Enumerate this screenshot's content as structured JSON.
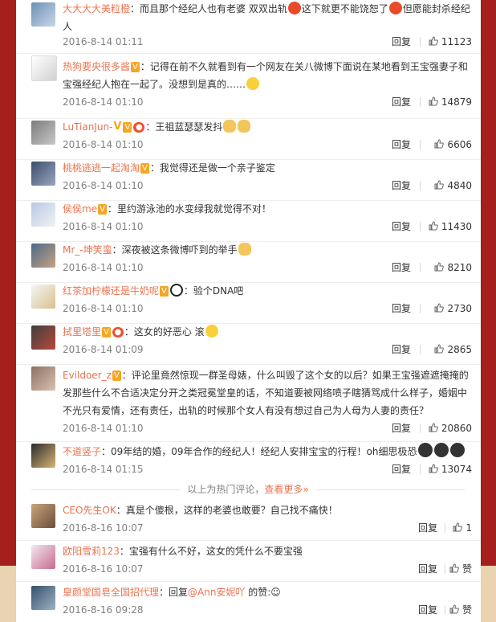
{
  "colors": {
    "background": "#a5201c",
    "panel": "#ffffff",
    "username": "#eb7350",
    "meta": "#808080",
    "bottom_band": "#e9d3b1"
  },
  "hot_comments": [
    {
      "user": "大大大大美粒橙",
      "text": "：而且那个经纪人也有老婆 双双出轨",
      "text_b": "这下就更不能饶恕了",
      "text_c": "但愿能封杀经纪人",
      "time": "2016-8-14 01:11",
      "reply": "回复",
      "likes": "11123"
    },
    {
      "user": "热狗要央很多酱",
      "text": "：记得在前不久就看到有一个网友在关八微博下面说在某地看到王宝强妻子和宝强经纪人抱在一起了。没想到是真的……",
      "time": "2016-8-14 01:10",
      "reply": "回复",
      "likes": "14879"
    },
    {
      "user": "LuTianJun-",
      "text": "：王祖蓝瑟瑟发抖",
      "time": "2016-8-14 01:10",
      "reply": "回复",
      "likes": "6606"
    },
    {
      "user": "桃桃逃逃一起淘淘",
      "text": "：我觉得还是做一个亲子鉴定",
      "time": "2016-8-14 01:10",
      "reply": "回复",
      "likes": "4840"
    },
    {
      "user": "侯侯me",
      "text": "：里约游泳池的水变绿我就觉得不对！",
      "time": "2016-8-14 01:10",
      "reply": "回复",
      "likes": "11430"
    },
    {
      "user": "Mr_-坤笑蛮",
      "text": "：深夜被这条微博吓到的举手",
      "time": "2016-8-14 01:10",
      "reply": "回复",
      "likes": "8210"
    },
    {
      "user": "红茶加柠檬还是牛奶呢",
      "text": "：验个DNA吧",
      "time": "2016-8-14 01:10",
      "reply": "回复",
      "likes": "2730"
    },
    {
      "user": "拭里塔里",
      "text": "：这女的好恶心 滚",
      "time": "2016-8-14 01:09",
      "reply": "回复",
      "likes": "2865"
    },
    {
      "user": "Evildoer_z",
      "text": "：评论里竟然惊现一群圣母婊，什么叫毁了这个女的以后？如果王宝强遮遮掩掩的发那些什么不合适决定分开之类冠冕堂皇的话，不知道要被网络喷子瞎猜骂成什么样子，婚姻中不光只有爱情，还有责任，出轨的时候那个女人有没有想过自己为人母为人妻的责任？",
      "time": "2016-8-14 01:10",
      "reply": "回复",
      "likes": "20860"
    },
    {
      "user": "不道竖子",
      "text": "：09年结的婚，09年合作的经纪人！经纪人安排宝宝的行程！oh细思极恐",
      "time": "2016-8-14 01:15",
      "reply": "回复",
      "likes": "13074"
    }
  ],
  "divider": {
    "text": "以上为热门评论，",
    "more_link": "查看更多»"
  },
  "new_comments": [
    {
      "user": "CEO先生OK",
      "text": "：真是个傻根，这样的老婆也敢要？自己找不痛快！",
      "time": "2016-8-16 10:07",
      "reply": "回复",
      "likes": "1"
    },
    {
      "user": "欧阳雪莉123",
      "text": "：宝强有什么不好，这女的凭什么不要宝强",
      "time": "2016-8-16 10:07",
      "reply": "回复",
      "likes": "赞"
    },
    {
      "user": "皇颜堂国皂全国招代理",
      "text_a": "：回复",
      "mention": "@Ann安妮吖",
      "text_b": " 的赞:☺",
      "time": "2016-8-16 09:28",
      "reply": "回复",
      "likes": "赞"
    }
  ]
}
